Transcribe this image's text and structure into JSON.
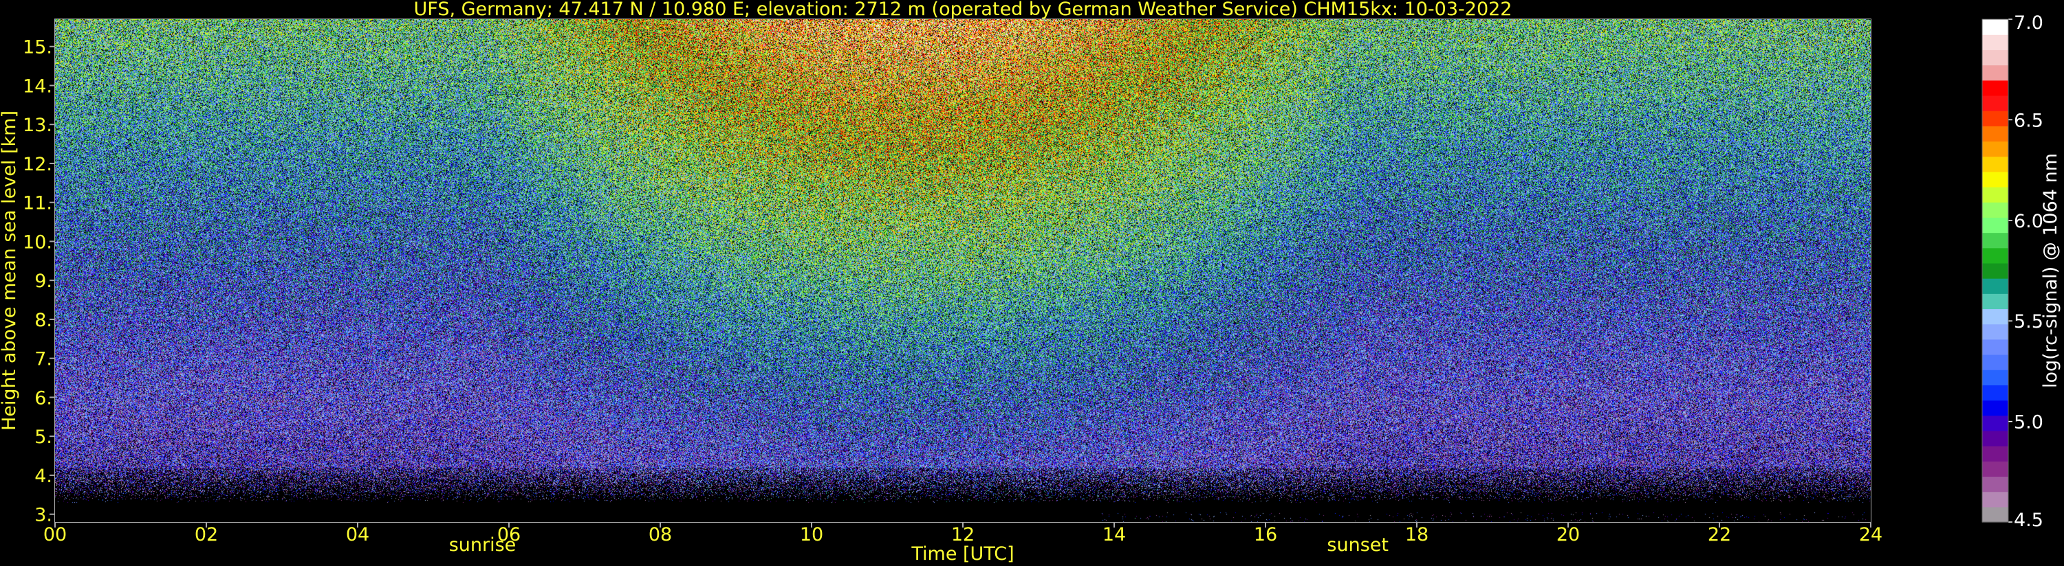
{
  "chart_data": {
    "type": "heatmap",
    "title": "UFS, Germany; 47.417 N / 10.980 E; elevation: 2712 m  (operated by German Weather Service)    CHM15kx: 10-03-2022",
    "xlabel": "Time [UTC]",
    "ylabel": "Height above mean sea level [km]",
    "xlim": [
      0,
      24
    ],
    "ylim": [
      2.8,
      15.7
    ],
    "x_ticks": [
      "00",
      "02",
      "04",
      "06",
      "08",
      "10",
      "12",
      "14",
      "16",
      "18",
      "20",
      "22",
      "24"
    ],
    "y_ticks": [
      "3.",
      "4.",
      "5.",
      "6.",
      "7.",
      "8.",
      "9.",
      "10.",
      "11.",
      "12.",
      "13.",
      "14.",
      "15."
    ],
    "grid": true,
    "events": [
      {
        "label": "sunrise",
        "x": 5.65
      },
      {
        "label": "sunset",
        "x": 17.22
      }
    ],
    "colorbar": {
      "label": "log(rc-signal) @ 1064 nm",
      "range": [
        4.5,
        7.0
      ],
      "ticks": [
        "4.5",
        "5.0",
        "5.5",
        "6.0",
        "6.5",
        "7.0"
      ],
      "colors": [
        "#a09aa0",
        "#b487b4",
        "#a05aa0",
        "#8c2d8c",
        "#78148c",
        "#5a00a0",
        "#3c00c8",
        "#0000f0",
        "#0a32ff",
        "#2864ff",
        "#5078ff",
        "#6e8cff",
        "#8caaff",
        "#a0c8ff",
        "#50c8b4",
        "#14a08c",
        "#14961e",
        "#1eb41e",
        "#46d250",
        "#78ff78",
        "#96ff64",
        "#c8ff32",
        "#fafa00",
        "#ffd200",
        "#ffa000",
        "#ff7800",
        "#ff3c00",
        "#ff1414",
        "#ff0000",
        "#f0a0a0",
        "#f5c8c8",
        "#fadcdc",
        "#ffffff"
      ]
    }
  },
  "colors": {
    "background": "#000000",
    "text": "#ffff33",
    "grid": "#ffff00",
    "event_line": "#ffffff"
  }
}
